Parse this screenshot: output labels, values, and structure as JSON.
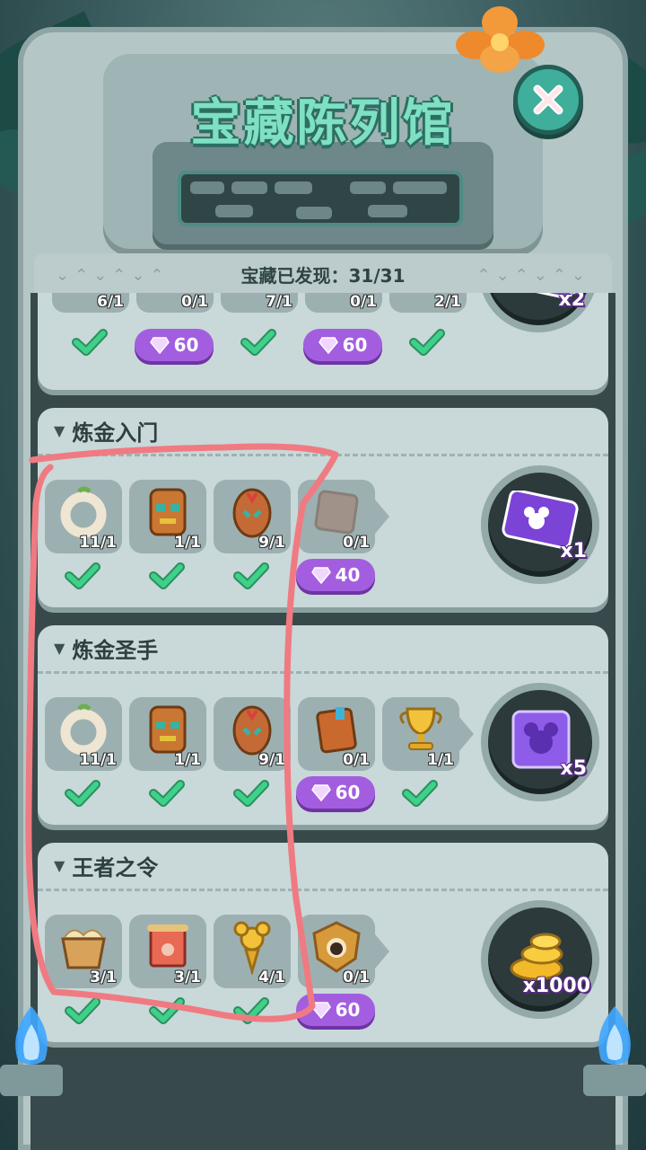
{
  "header": {
    "title": "宝藏陈列馆",
    "progress_label": "宝藏已发现：31/31"
  },
  "colors": {
    "accent_teal": "#7fe0c3",
    "gem_purple": "#a35ee0",
    "check_green": "#3fd08a",
    "annotation_pink": "#f07a82"
  },
  "cards": [
    {
      "name": "",
      "items": [
        {
          "icon": "mickey-shield-icon",
          "count": "6/1",
          "status": "check"
        },
        {
          "icon": "golden-cup-icon",
          "count": "0/1",
          "status": "gem",
          "gem": "60"
        },
        {
          "icon": "golden-key-icon",
          "count": "7/1",
          "status": "check"
        },
        {
          "icon": "mickey-shield-icon",
          "count": "0/1",
          "status": "gem",
          "gem": "60"
        },
        {
          "icon": "crystal-map-icon",
          "count": "2/1",
          "status": "check"
        }
      ],
      "reward": {
        "icon": "sticker-card-icon",
        "multiplier": "x2"
      }
    },
    {
      "name": "炼金入门",
      "items": [
        {
          "icon": "bone-ring-icon",
          "count": "11/1",
          "status": "check"
        },
        {
          "icon": "tiki-mask-icon",
          "count": "1/1",
          "status": "check"
        },
        {
          "icon": "tribal-shield-icon",
          "count": "9/1",
          "status": "check"
        },
        {
          "icon": "stone-tablet-icon",
          "count": "0/1",
          "status": "gem",
          "gem": "40"
        }
      ],
      "reward": {
        "icon": "sticker-card-icon",
        "multiplier": "x1"
      }
    },
    {
      "name": "炼金圣手",
      "items": [
        {
          "icon": "bone-ring-icon",
          "count": "11/1",
          "status": "check"
        },
        {
          "icon": "tiki-mask-icon",
          "count": "1/1",
          "status": "check"
        },
        {
          "icon": "tribal-shield-icon",
          "count": "9/1",
          "status": "check"
        },
        {
          "icon": "treasure-book-icon",
          "count": "0/1",
          "status": "gem",
          "gem": "60"
        },
        {
          "icon": "golden-trophy-icon",
          "count": "1/1",
          "status": "check"
        }
      ],
      "reward": {
        "icon": "mystery-ticket-icon",
        "multiplier": "x5"
      }
    },
    {
      "name": "王者之令",
      "items": [
        {
          "icon": "wooden-basket-icon",
          "count": "3/1",
          "status": "check"
        },
        {
          "icon": "mickey-scroll-icon",
          "count": "3/1",
          "status": "check"
        },
        {
          "icon": "mickey-scepter-icon",
          "count": "4/1",
          "status": "check"
        },
        {
          "icon": "mickey-shield-icon",
          "count": "0/1",
          "status": "gem",
          "gem": "60"
        }
      ],
      "reward": {
        "icon": "gold-coins-icon",
        "multiplier": "x1000"
      }
    }
  ]
}
